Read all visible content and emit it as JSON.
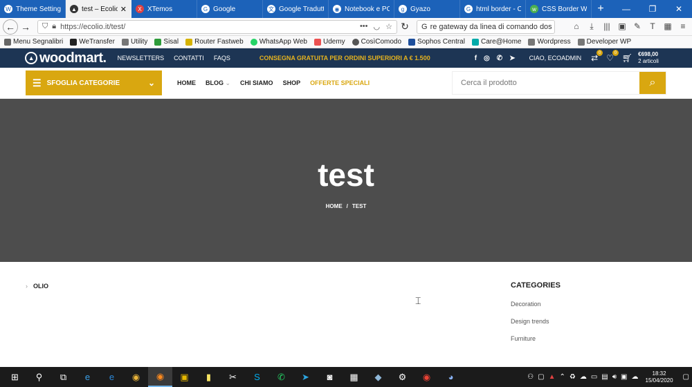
{
  "browser": {
    "tabs": [
      {
        "label": "Theme Settings ‹ Ec",
        "icon": "wp-icon",
        "active": false
      },
      {
        "label": "test – Ecolio",
        "icon": "woodmart-icon",
        "active": true
      },
      {
        "label": "XTemos",
        "icon": "xtemos-icon",
        "active": false
      },
      {
        "label": "Google",
        "icon": "google-icon",
        "active": false
      },
      {
        "label": "Google Tradutto",
        "icon": "translate-icon",
        "active": false
      },
      {
        "label": "Notebook e PC",
        "icon": "notebook-icon",
        "active": false
      },
      {
        "label": "Gyazo",
        "icon": "gyazo-icon",
        "active": false
      },
      {
        "label": "html border - C",
        "icon": "google-icon",
        "active": false
      },
      {
        "label": "CSS Border Wid",
        "icon": "w3-icon",
        "active": false
      }
    ],
    "url": "https://ecolio.it/test/",
    "search_value": "re gateway da linea di comando dos"
  },
  "bookmarks": [
    {
      "label": "Menu Segnalibri",
      "color": "#666"
    },
    {
      "label": "WeTransfer",
      "color": "#222"
    },
    {
      "label": "Utility",
      "color": "#777"
    },
    {
      "label": "Sisal",
      "color": "#2e9b3a"
    },
    {
      "label": "Router Fastweb",
      "color": "#d6b200"
    },
    {
      "label": "WhatsApp Web",
      "color": "#25d366"
    },
    {
      "label": "Udemy",
      "color": "#ec5252"
    },
    {
      "label": "CosìComodo",
      "color": "#555"
    },
    {
      "label": "Sophos Central",
      "color": "#1e4f9c"
    },
    {
      "label": "Care@Home",
      "color": "#0aa"
    },
    {
      "label": "Wordpress",
      "color": "#777"
    },
    {
      "label": "Developer WP",
      "color": "#777"
    }
  ],
  "site": {
    "logo": "woodmart.",
    "top_links": [
      "NEWSLETTERS",
      "CONTATTI",
      "FAQS"
    ],
    "promo": "CONSEGNA GRATUITA PER ORDINI SUPERIORI A € 1.500",
    "social": [
      "f",
      "◎",
      "✆",
      "➤"
    ],
    "greeting": "CIAO, ECOADMIN",
    "compare_count": "0",
    "wishlist_count": "0",
    "cart_total": "€698,00",
    "cart_items": "2 articoli",
    "categories_button": "SFOGLIA CATEGORIE",
    "nav": [
      "HOME",
      "BLOG",
      "CHI SIAMO",
      "SHOP"
    ],
    "nav_special": "OFFERTE SPECIALI",
    "search_placeholder": "Cerca il prodotto",
    "accent": "#d9a710",
    "topbar_color": "#1d3554"
  },
  "hero": {
    "title": "test",
    "breadcrumb": [
      "HOME",
      "/",
      "TEST"
    ]
  },
  "content": {
    "category_item": "OLIO",
    "sidebar_title": "CATEGORIES",
    "sidebar_links": [
      "Decoration",
      "Design trends",
      "Furniture"
    ]
  },
  "taskbar": {
    "time": "18:32",
    "date": "15/04/2020"
  }
}
